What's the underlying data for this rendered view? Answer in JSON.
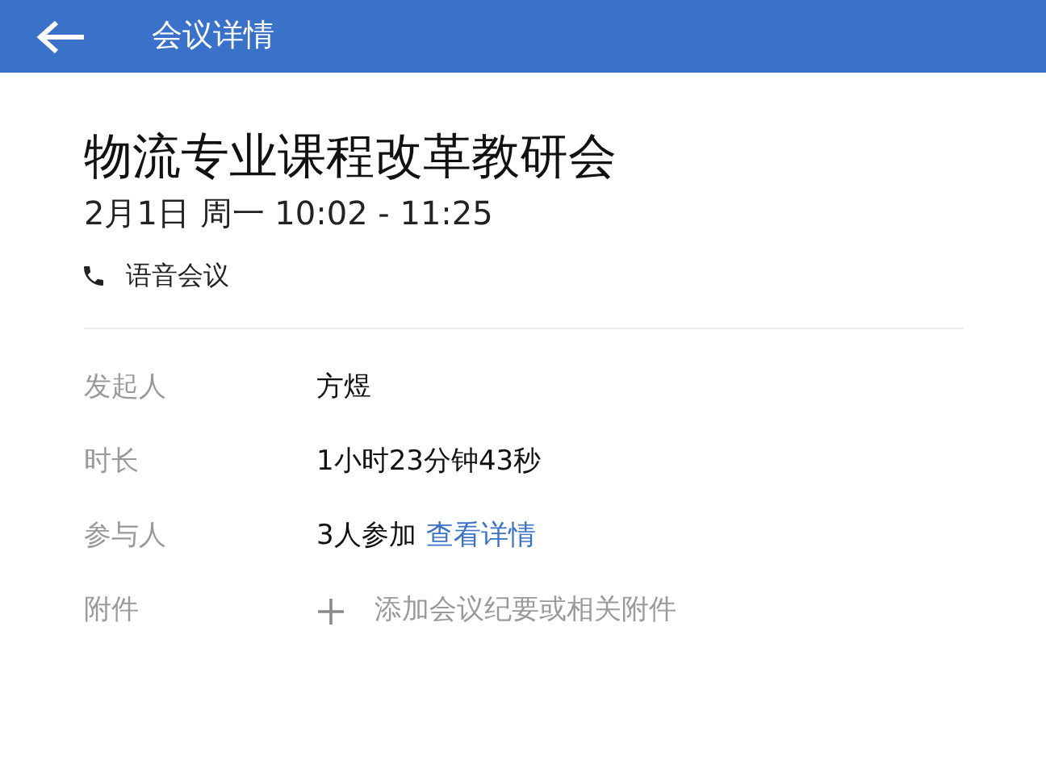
{
  "header": {
    "title": "会议详情"
  },
  "meeting": {
    "title": "物流专业课程改革教研会",
    "time": "2月1日 周一 10:02 - 11:25",
    "type": "语音会议"
  },
  "details": [
    {
      "kind": "text",
      "label": "发起人",
      "value": "方煜"
    },
    {
      "kind": "text",
      "label": "时长",
      "value": "1小时23分钟43秒"
    },
    {
      "kind": "link",
      "label": "参与人",
      "value": "3人参加",
      "link": "查看详情"
    },
    {
      "kind": "add",
      "label": "附件",
      "value": "添加会议纪要或相关附件"
    }
  ]
}
